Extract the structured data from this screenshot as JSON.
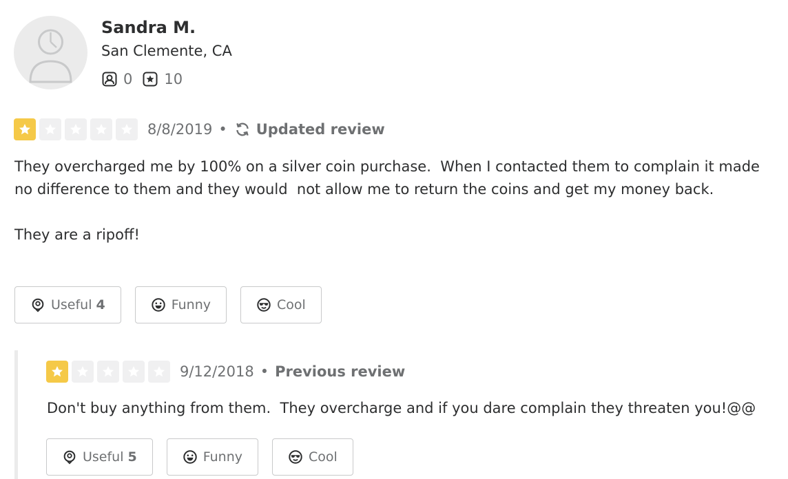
{
  "user": {
    "name": "Sandra M.",
    "location": "San Clemente, CA",
    "friends_count": "0",
    "reviews_count": "10",
    "icons": {
      "avatar": "default-avatar-icon",
      "friends": "friends-icon",
      "reviews": "review-star-icon"
    }
  },
  "updated_review": {
    "rating": 1,
    "max_rating": 5,
    "date": "8/8/2019",
    "separator": "•",
    "label": "Updated review",
    "label_icon": "refresh-icon",
    "text": "They overcharged me by 100% on a silver coin purchase.  When I contacted them to complain it made no difference to them and they would  not allow me to return the coins and get my money back.\n\nThey are a ripoff!",
    "votes": {
      "useful_label": "Useful",
      "useful_count": "4",
      "funny_label": "Funny",
      "cool_label": "Cool"
    }
  },
  "previous_review": {
    "rating": 1,
    "max_rating": 5,
    "date": "9/12/2018",
    "separator": "•",
    "label": "Previous review",
    "text": "Don't buy anything from them.  They overcharge and if you dare complain they threaten you!@@",
    "votes": {
      "useful_label": "Useful",
      "useful_count": "5",
      "funny_label": "Funny",
      "cool_label": "Cool"
    }
  },
  "colors": {
    "star_filled": "#f5c948",
    "star_empty": "#f0f0f1",
    "text_primary": "#2d2e2f",
    "text_secondary": "#6e7072",
    "border": "#c8c9ca"
  }
}
